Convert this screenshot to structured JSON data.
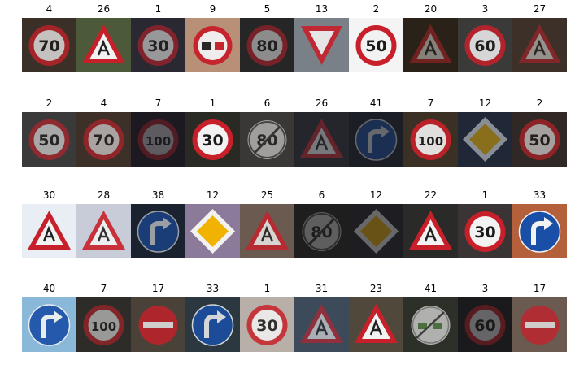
{
  "rows": [
    [
      {
        "label": "4",
        "sign": "speed",
        "text": "70",
        "bg": "#3a3028",
        "dim": 0.75
      },
      {
        "label": "26",
        "sign": "triangle",
        "bg": "#4c5a3a",
        "dim": 1.0
      },
      {
        "label": "1",
        "sign": "speed",
        "text": "30",
        "bg": "#2a2830",
        "dim": 0.55
      },
      {
        "label": "9",
        "sign": "noovertaking",
        "bg": "#b89078",
        "dim": 0.95
      },
      {
        "label": "5",
        "sign": "speed",
        "text": "80",
        "bg": "#262626",
        "dim": 0.5
      },
      {
        "label": "13",
        "sign": "yield",
        "bg": "#7a8088",
        "dim": 0.9
      },
      {
        "label": "2",
        "sign": "speed",
        "text": "50",
        "bg": "#f4f4f4",
        "dim": 1.0
      },
      {
        "label": "20",
        "sign": "triangle",
        "bg": "#2a2218",
        "dim": 0.45
      },
      {
        "label": "3",
        "sign": "speed",
        "text": "60",
        "bg": "#3a3a38",
        "dim": 0.85
      },
      {
        "label": "27",
        "sign": "triangle",
        "bg": "#3c3028",
        "dim": 0.5
      }
    ],
    [
      {
        "label": "2",
        "sign": "speed",
        "text": "50",
        "bg": "#3a3a3a",
        "dim": 0.6
      },
      {
        "label": "4",
        "sign": "speed",
        "text": "70",
        "bg": "#3c3028",
        "dim": 0.6
      },
      {
        "label": "7",
        "sign": "speed",
        "text": "100",
        "bg": "#1c1a20",
        "dim": 0.3
      },
      {
        "label": "1",
        "sign": "speed",
        "text": "30",
        "bg": "#2a2a24",
        "dim": 1.0
      },
      {
        "label": "6",
        "sign": "endspeed",
        "text": "80",
        "bg": "#3a3836",
        "dim": 0.55
      },
      {
        "label": "26",
        "sign": "triangle",
        "bg": "#24262c",
        "dim": 0.4
      },
      {
        "label": "41",
        "sign": "blue",
        "bg": "#1c1e26",
        "dim": 0.35
      },
      {
        "label": "7",
        "sign": "speed",
        "text": "100",
        "bg": "#3a3024",
        "dim": 0.9
      },
      {
        "label": "12",
        "sign": "diamond",
        "bg": "#202838",
        "dim": 0.5
      },
      {
        "label": "2",
        "sign": "speed",
        "text": "50",
        "bg": "#302824",
        "dim": 0.6
      }
    ],
    [
      {
        "label": "30",
        "sign": "triangle",
        "bg": "#e8eef4",
        "dim": 1.0
      },
      {
        "label": "28",
        "sign": "triangle",
        "bg": "#c8ccd8",
        "dim": 0.9
      },
      {
        "label": "38",
        "sign": "blue",
        "bg": "#1a2230",
        "dim": 0.6
      },
      {
        "label": "12",
        "sign": "diamond",
        "bg": "#8c7a9a",
        "dim": 1.0
      },
      {
        "label": "25",
        "sign": "triangle",
        "bg": "#6a5a50",
        "dim": 0.8
      },
      {
        "label": "6",
        "sign": "endspeed",
        "text": "80",
        "bg": "#1e1e1e",
        "dim": 0.3
      },
      {
        "label": "12",
        "sign": "diamond",
        "bg": "#1e1e22",
        "dim": 0.35
      },
      {
        "label": "22",
        "sign": "triangle",
        "bg": "#2a2a28",
        "dim": 1.0
      },
      {
        "label": "1",
        "sign": "speed",
        "text": "30",
        "bg": "#3a3434",
        "dim": 1.0
      },
      {
        "label": "33",
        "sign": "blue",
        "bg": "#b4603a",
        "dim": 1.0
      }
    ],
    [
      {
        "label": "40",
        "sign": "blue",
        "bg": "#8ab8d8",
        "dim": 0.9
      },
      {
        "label": "7",
        "sign": "speed",
        "text": "100",
        "bg": "#2e2c28",
        "dim": 0.55
      },
      {
        "label": "17",
        "sign": "noentry",
        "bg": "#4a4238",
        "dim": 0.8
      },
      {
        "label": "33",
        "sign": "blue",
        "bg": "#2c3840",
        "dim": 0.85
      },
      {
        "label": "1",
        "sign": "speed",
        "text": "30",
        "bg": "#b8b0a8",
        "dim": 0.85
      },
      {
        "label": "31",
        "sign": "triangle",
        "bg": "#3c4a5a",
        "dim": 0.6
      },
      {
        "label": "23",
        "sign": "triangle",
        "bg": "#50483a",
        "dim": 1.0
      },
      {
        "label": "41",
        "sign": "endovertaking",
        "bg": "#2c3028",
        "dim": 0.7
      },
      {
        "label": "3",
        "sign": "speed",
        "text": "60",
        "bg": "#1a1a1c",
        "dim": 0.35
      },
      {
        "label": "17",
        "sign": "noentry",
        "bg": "#6a5a50",
        "dim": 0.75
      }
    ]
  ]
}
